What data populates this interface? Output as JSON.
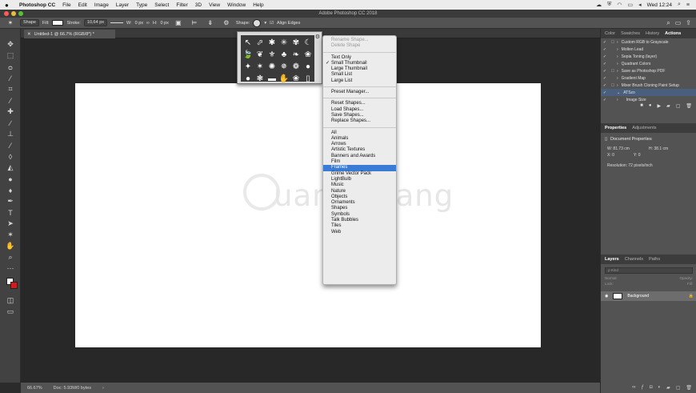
{
  "menubar": {
    "app_name": "Photoshop CC",
    "items": [
      "File",
      "Edit",
      "Image",
      "Layer",
      "Type",
      "Select",
      "Filter",
      "3D",
      "View",
      "Window",
      "Help"
    ],
    "clock": "Wed 12:24"
  },
  "window": {
    "title": "Adobe Photoshop CC 2018"
  },
  "options_bar": {
    "mode": "Shape",
    "fill_label": "Fill:",
    "stroke_label": "Stroke:",
    "stroke_width": "10,64 px",
    "w_label": "W:",
    "w_value": "0 px",
    "h_label": "H:",
    "h_value": "0 px",
    "shape_label": "Shape:",
    "align_edges": "Align Edges"
  },
  "document": {
    "tab_title": "Untitled-1 @ 66.7% (RGB/8*) *",
    "watermark_text": "uantrimang"
  },
  "status_bar": {
    "zoom": "66.67%",
    "doc_info": "Doc: 5.93M/0 bytes"
  },
  "shape_picker": {
    "shapes": [
      "↖",
      "⬀",
      "✱",
      "✳",
      "✾",
      "☾",
      "🍃",
      "❦",
      "⚜",
      "♣",
      "❧",
      "❀",
      "✦",
      "✶",
      "✺",
      "✵",
      "❁",
      "●",
      "●",
      "❃",
      "▬",
      "✋",
      "❀",
      "▯"
    ]
  },
  "shape_menu": {
    "items": [
      {
        "label": "Rename Shape...",
        "state": "disabled"
      },
      {
        "label": "Delete Shape",
        "state": "disabled"
      },
      {
        "sep": true
      },
      {
        "label": "Text Only",
        "state": "normal"
      },
      {
        "label": "Small Thumbnail",
        "state": "checked"
      },
      {
        "label": "Large Thumbnail",
        "state": "normal"
      },
      {
        "label": "Small List",
        "state": "normal"
      },
      {
        "label": "Large List",
        "state": "normal"
      },
      {
        "sep": true
      },
      {
        "label": "Preset Manager...",
        "state": "normal"
      },
      {
        "sep": true
      },
      {
        "label": "Reset Shapes...",
        "state": "normal"
      },
      {
        "label": "Load Shapes...",
        "state": "normal"
      },
      {
        "label": "Save Shapes...",
        "state": "normal"
      },
      {
        "label": "Replace Shapes...",
        "state": "normal"
      },
      {
        "sep": true
      },
      {
        "label": "All",
        "state": "normal"
      },
      {
        "label": "Animals",
        "state": "normal"
      },
      {
        "label": "Arrows",
        "state": "normal"
      },
      {
        "label": "Artistic Textures",
        "state": "normal"
      },
      {
        "label": "Banners and Awards",
        "state": "normal"
      },
      {
        "label": "Film",
        "state": "normal"
      },
      {
        "label": "Frames",
        "state": "highlighted"
      },
      {
        "label": "Grime Vector Pack",
        "state": "normal"
      },
      {
        "label": "LightBulb",
        "state": "normal"
      },
      {
        "label": "Music",
        "state": "normal"
      },
      {
        "label": "Nature",
        "state": "normal"
      },
      {
        "label": "Objects",
        "state": "normal"
      },
      {
        "label": "Ornaments",
        "state": "normal"
      },
      {
        "label": "Shapes",
        "state": "normal"
      },
      {
        "label": "Symbols",
        "state": "normal"
      },
      {
        "label": "Talk Bubbles",
        "state": "normal"
      },
      {
        "label": "Tiles",
        "state": "normal"
      },
      {
        "label": "Web",
        "state": "normal"
      }
    ]
  },
  "panels": {
    "top_tabs": [
      "Color",
      "Swatches",
      "History",
      "Actions"
    ],
    "active_top_tab": "Actions",
    "actions": [
      {
        "name": "Custom RGB to Grayscale",
        "dialog": "☐",
        "sub": false
      },
      {
        "name": "Molten Lead",
        "dialog": "",
        "sub": false
      },
      {
        "name": "Sepia Toning (layer)",
        "dialog": "",
        "sub": false
      },
      {
        "name": "Quadrant Colors",
        "dialog": "",
        "sub": false
      },
      {
        "name": "Save as Photoshop PDF",
        "dialog": "☐",
        "sub": false
      },
      {
        "name": "Gradient Map",
        "dialog": "",
        "sub": false
      },
      {
        "name": "Mixer Brush Cloning Paint Setup",
        "dialog": "☐",
        "sub": false
      },
      {
        "name": "ATSzo",
        "dialog": "",
        "sub": false
      },
      {
        "name": "Image Size",
        "dialog": "",
        "sub": true
      }
    ],
    "props_tabs": [
      "Properties",
      "Adjustments"
    ],
    "props_heading": "Document Properties",
    "props_w": "W: 81.73 cm",
    "props_h": "H: 38.1 cm",
    "props_x": "X: 0",
    "props_y": "Y: 0",
    "props_resolution": "Resolution: 72 pixels/inch",
    "layer_tabs": [
      "Layers",
      "Channels",
      "Paths"
    ],
    "layer_search": "ρ Kind",
    "layer_mode": "Normal",
    "layer_opacity": "Opacity:",
    "layer_lock": "Lock:",
    "layer_fill": "Fill:",
    "layer_name": "Background"
  }
}
